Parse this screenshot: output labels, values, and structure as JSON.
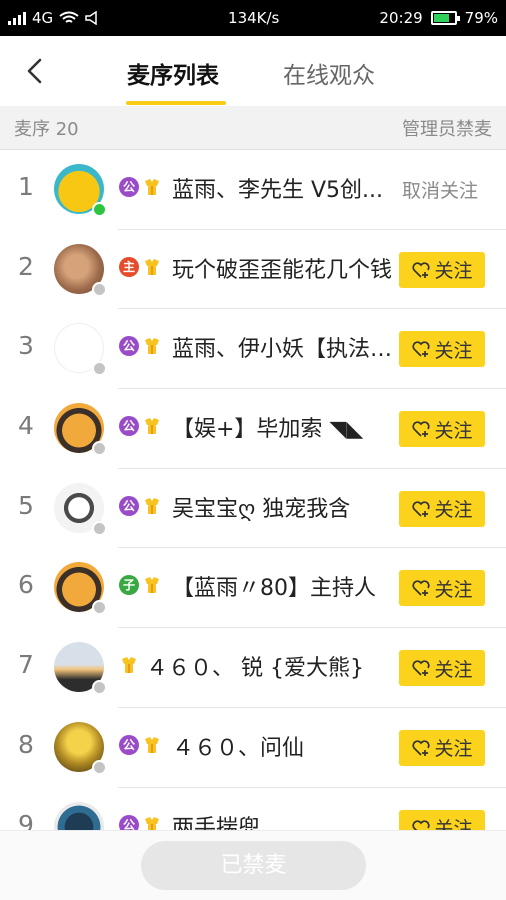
{
  "status_bar": {
    "network": "4G",
    "speed": "134K/s",
    "time": "20:29",
    "battery": "79%",
    "battery_level": 0.79
  },
  "header": {
    "tabs": [
      {
        "label": "麦序列表",
        "active": true
      },
      {
        "label": "在线观众",
        "active": false
      }
    ]
  },
  "subbar": {
    "left_label": "麦序",
    "count": "20",
    "right_label": "管理员禁麦"
  },
  "follow_label": "关注",
  "unfollow_label": "取消关注",
  "rows": [
    {
      "rank": "1",
      "badge": "公",
      "name": "蓝雨、李先生 V5创...",
      "online": true,
      "action": "unfollow"
    },
    {
      "rank": "2",
      "badge": "主",
      "name": "玩个破歪歪能花几个钱",
      "online": false,
      "action": "follow"
    },
    {
      "rank": "3",
      "badge": "公",
      "name": "蓝雨、伊小妖【执法官】",
      "online": false,
      "action": "follow"
    },
    {
      "rank": "4",
      "badge": "公",
      "name": "【娱+】毕加索 ◥◣",
      "online": false,
      "action": "follow"
    },
    {
      "rank": "5",
      "badge": "公",
      "name": "吴宝宝ღ 独宠我含",
      "online": false,
      "action": "follow"
    },
    {
      "rank": "6",
      "badge": "子",
      "name": "【蓝雨〃80】主持人",
      "online": false,
      "action": "follow"
    },
    {
      "rank": "7",
      "badge": "",
      "name": "４６０、 锐 {爱大熊}",
      "online": false,
      "action": "follow"
    },
    {
      "rank": "8",
      "badge": "公",
      "name": "４６０、问仙",
      "online": false,
      "action": "follow"
    },
    {
      "rank": "9",
      "badge": "公",
      "name": "两手揣兜",
      "online": false,
      "action": "follow"
    }
  ],
  "bottom": {
    "button_label": "已禁麦"
  },
  "colors": {
    "accent": "#fbd31c",
    "online": "#2cc541",
    "gong_badge": "#9a4bc8",
    "zhu_badge": "#e64b2b",
    "zi_badge": "#39a843"
  }
}
